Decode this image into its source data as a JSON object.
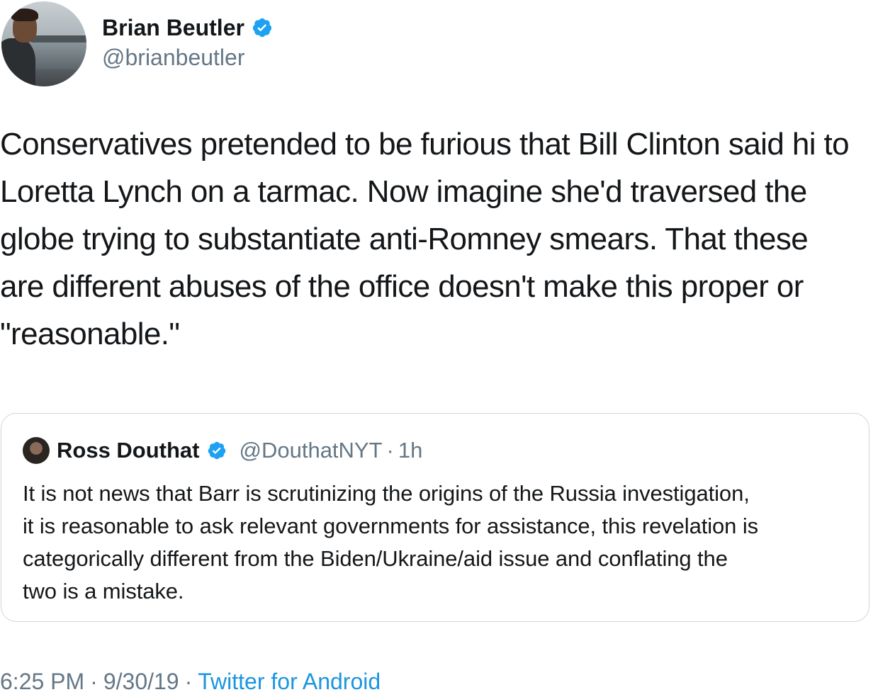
{
  "author": {
    "display_name": "Brian Beutler",
    "handle": "@brianbeutler",
    "verified": true
  },
  "tweet": {
    "text": "Conservatives pretended to be furious that Bill Clinton said hi to\nLoretta Lynch on a tarmac. Now imagine she'd traversed the\nglobe trying to substantiate anti-Romney smears. That these\nare different abuses of the office doesn't make this proper or\n\"reasonable.\""
  },
  "quoted_tweet": {
    "display_name": "Ross Douthat",
    "handle": "@DouthatNYT",
    "separator": "·",
    "time": "1h",
    "verified": true,
    "text": "It is not news that Barr is scrutinizing the origins of the Russia investigation,\nit is reasonable to ask relevant governments for assistance, this revelation is\ncategorically different from the Biden/Ukraine/aid issue and conflating the\ntwo is a mistake."
  },
  "meta": {
    "time": "6:25 PM",
    "separator": "·",
    "date": "9/30/19",
    "source": "Twitter for Android"
  },
  "icons": {
    "verified": "verified-badge-icon"
  },
  "colors": {
    "text": "#14171a",
    "secondary": "#657786",
    "accent": "#1b95e0",
    "verified": "#1da1f2",
    "border": "#ccd6dd"
  }
}
